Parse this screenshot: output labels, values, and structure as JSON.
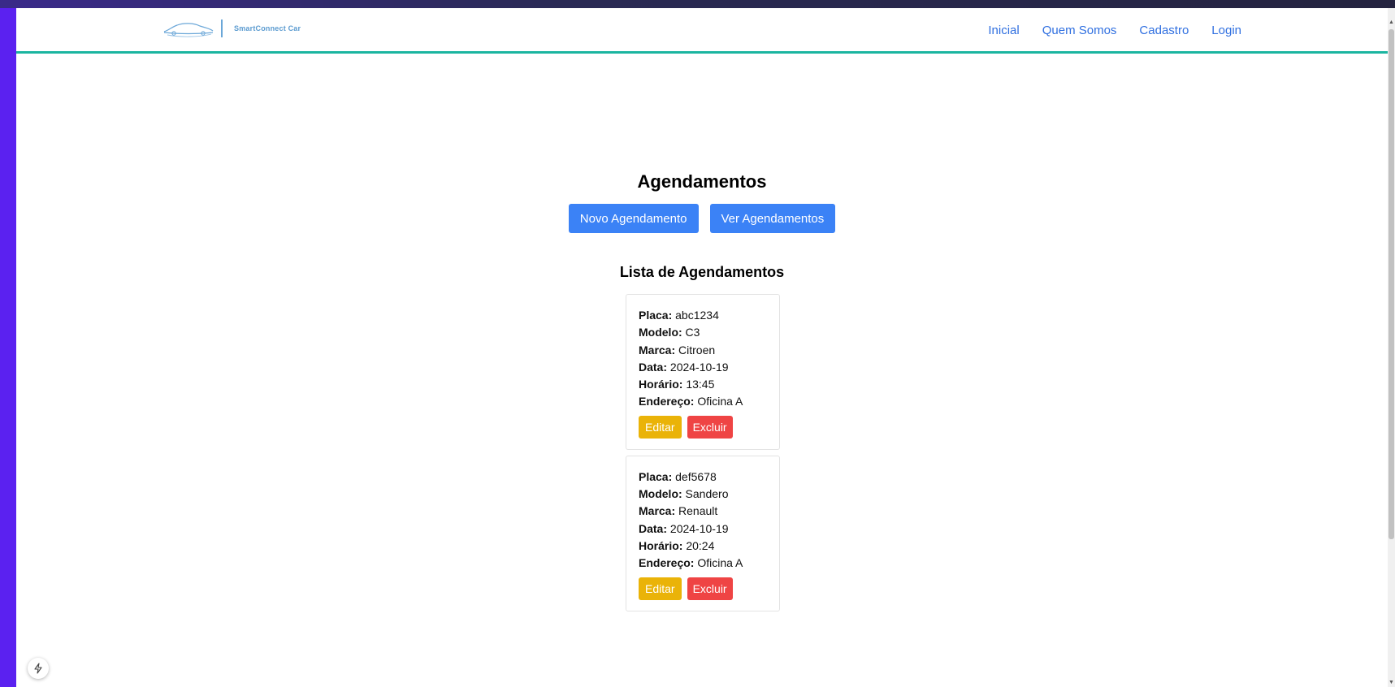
{
  "header": {
    "brand_name": "SmartConnect Car",
    "nav": [
      {
        "label": "Inicial"
      },
      {
        "label": "Quem Somos"
      },
      {
        "label": "Cadastro"
      },
      {
        "label": "Login"
      }
    ]
  },
  "main": {
    "title": "Agendamentos",
    "new_button": "Novo Agendamento",
    "view_button": "Ver Agendamentos",
    "list_title": "Lista de Agendamentos",
    "field_labels": {
      "placa": "Placa:",
      "modelo": "Modelo:",
      "marca": "Marca:",
      "data": "Data:",
      "horario": "Horário:",
      "endereco": "Endereço:"
    },
    "edit_label": "Editar",
    "delete_label": "Excluir",
    "appointments": [
      {
        "placa": "abc1234",
        "modelo": "C3",
        "marca": "Citroen",
        "data": "2024-10-19",
        "horario": "13:45",
        "endereco": "Oficina A"
      },
      {
        "placa": "def5678",
        "modelo": "Sandero",
        "marca": "Renault",
        "data": "2024-10-19",
        "horario": "20:24",
        "endereco": "Oficina A"
      }
    ]
  },
  "colors": {
    "primary": "#3b82f6",
    "edit": "#eab308",
    "delete": "#ef4444",
    "header_border": "#1bb5a0",
    "nav_link": "#2f6fe0",
    "desktop": "#5b21f0"
  },
  "icons": {
    "logo": "car-outline-icon",
    "floating": "lightning-icon"
  }
}
